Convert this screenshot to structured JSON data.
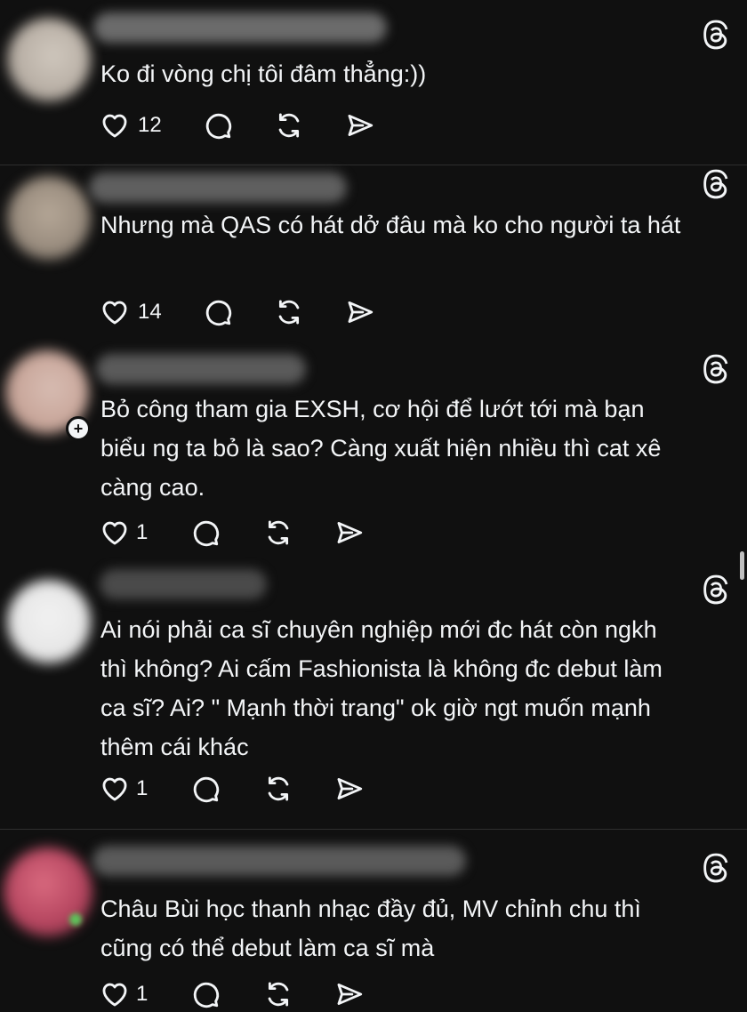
{
  "posts": [
    {
      "text": "Ko đi vòng chị tôi đâm thẳng:))",
      "likes": "12"
    },
    {
      "text": "Nhưng mà QAS có hát dở đâu mà ko cho người ta hát",
      "likes": "14"
    },
    {
      "text": "Bỏ công tham gia EXSH, cơ hội để lướt tới mà bạn\nbiểu ng ta bỏ là sao? Càng xuất hiện nhiều thì cat xê\ncàng cao.",
      "likes": "1"
    },
    {
      "text": "Ai nói phải ca sĩ chuyên nghiệp mới đc hát còn ngkh\nthì không? Ai cấm Fashionista là không đc debut làm\nca sĩ? Ai? \" Mạnh thời trang\" ok giờ ngt muốn mạnh\nthêm cái khác",
      "likes": "1"
    },
    {
      "text": "Châu Bùi học thanh nhạc đầy đủ, MV chỉnh chu thì\ncũng có thể debut làm ca sĩ mà",
      "likes": "1"
    }
  ],
  "colors": {
    "background": "#101010",
    "text": "#f3f5f7",
    "divider": "#2e2e2e"
  },
  "icons": [
    "heart-icon",
    "comment-icon",
    "repost-icon",
    "share-icon",
    "threads-logo-icon"
  ]
}
